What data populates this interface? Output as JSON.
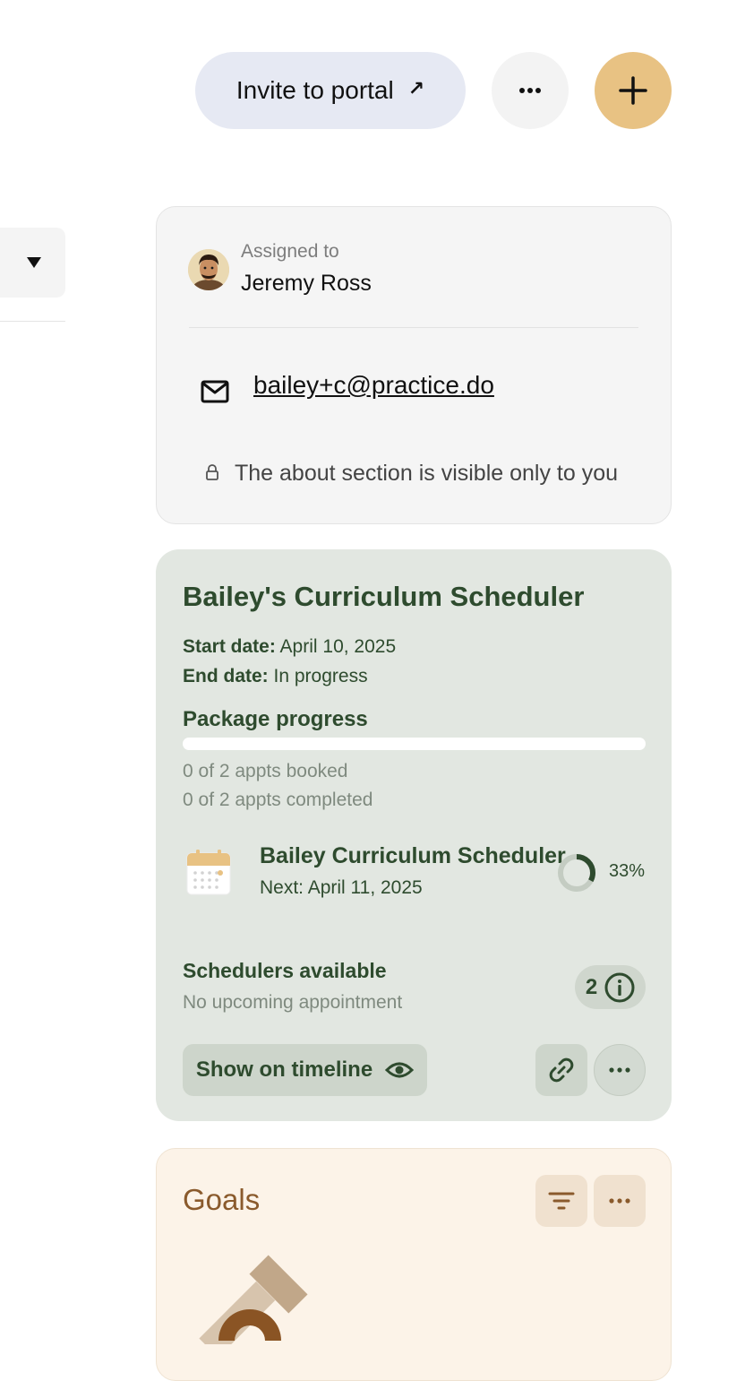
{
  "header": {
    "invite_label": "Invite to portal",
    "invite_arrow": "↗"
  },
  "about": {
    "assigned_label": "Assigned to",
    "assigned_name": "Jeremy Ross",
    "email": "bailey+c@practice.do",
    "privacy_note": "The about section is visible only to you"
  },
  "curriculum": {
    "title": "Bailey's Curriculum Scheduler",
    "start_label": "Start date:",
    "start_value": "April 10, 2025",
    "end_label": "End date:",
    "end_value": "In progress",
    "package_progress_label": "Package progress",
    "package_progress_fraction": 0,
    "appts_booked": "0 of 2 appts booked",
    "appts_completed": "0 of 2 appts completed",
    "scheduler_name": "Bailey Curriculum Scheduler",
    "scheduler_next": "Next: April 11, 2025",
    "scheduler_percent_label": "33%",
    "scheduler_percent": 33,
    "schedulers_available_label": "Schedulers available",
    "no_upcoming": "No upcoming appointment",
    "schedulers_count": "2",
    "show_timeline_label": "Show on timeline"
  },
  "goals": {
    "title": "Goals"
  },
  "colors": {
    "accent_gold": "#e8c283",
    "curriculum_bg": "#e2e7e1",
    "curriculum_text": "#2e4b2e",
    "goals_bg": "#fcf3e8",
    "goals_text": "#8a5a2c"
  },
  "icons": {
    "invite": "arrow-up-right-icon",
    "more": "more-horizontal-icon",
    "add": "plus-icon",
    "dropdown": "triangle-down-icon",
    "mail": "mail-icon",
    "lock": "lock-icon",
    "calendar": "calendar-icon",
    "info": "info-icon",
    "eye": "eye-icon",
    "link": "link-icon",
    "filter": "filter-icon"
  }
}
